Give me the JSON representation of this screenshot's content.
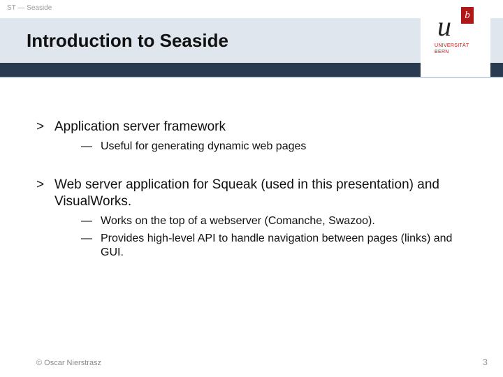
{
  "breadcrumb": "ST — Seaside",
  "title": "Introduction to Seaside",
  "logo": {
    "u": "u",
    "b": "b",
    "line1": "UNIVERSITÄT",
    "line2": "BERN"
  },
  "bullets": [
    {
      "text": "Application server framework",
      "sub": [
        "Useful for generating dynamic web pages"
      ]
    },
    {
      "text": "Web server application for Squeak (used in this presentation) and VisualWorks.",
      "sub": [
        "Works on the top of a webserver (Comanche, Swazoo).",
        "Provides high-level API to handle navigation between pages (links) and GUI."
      ]
    }
  ],
  "footer": {
    "copyright": "© Oscar Nierstrasz",
    "page": "3"
  },
  "markers": {
    "lvl1": ">",
    "lvl2": "—"
  }
}
